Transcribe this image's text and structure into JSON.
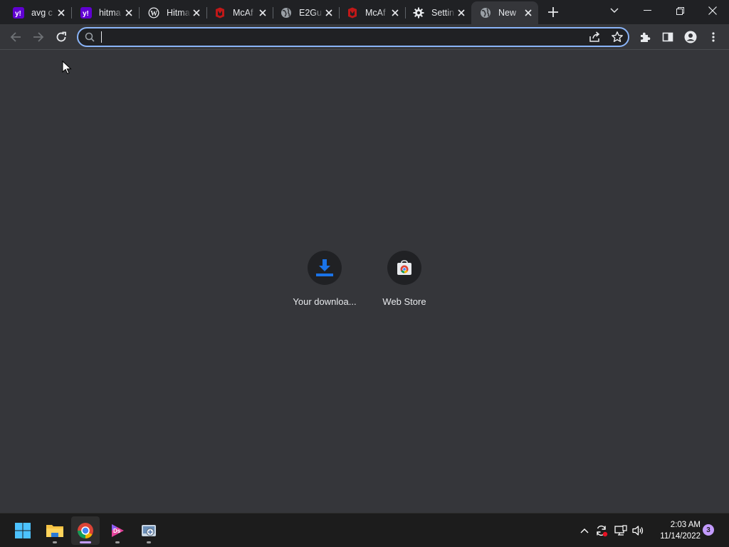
{
  "browser": {
    "tabs": [
      {
        "title": "avg c",
        "icon": "yahoo-icon"
      },
      {
        "title": "hitma",
        "icon": "yahoo-icon"
      },
      {
        "title": "Hitma",
        "icon": "wordpress-icon"
      },
      {
        "title": "McAf",
        "icon": "mcafee-icon"
      },
      {
        "title": "E2Gu",
        "icon": "globe-icon"
      },
      {
        "title": "McAf",
        "icon": "mcafee-icon"
      },
      {
        "title": "Settin",
        "icon": "gear-icon"
      },
      {
        "title": "New",
        "icon": "globe-icon",
        "active": true
      }
    ],
    "omnibox": {
      "value": "",
      "placeholder": ""
    },
    "colors": {
      "accent": "#8ab4f8",
      "tabstrip": "#202124",
      "toolbar": "#35363a"
    }
  },
  "shortcuts": [
    {
      "label": "Your downloa...",
      "icon": "download-icon"
    },
    {
      "label": "Web Store",
      "icon": "chrome-web-store-icon"
    }
  ],
  "taskbar": {
    "apps": [
      "windows-start-icon",
      "file-explorer-icon",
      "chrome-icon",
      "media-app-icon",
      "utility-app-icon"
    ],
    "time": "2:03 AM",
    "date": "11/14/2022",
    "notifications": "3"
  }
}
